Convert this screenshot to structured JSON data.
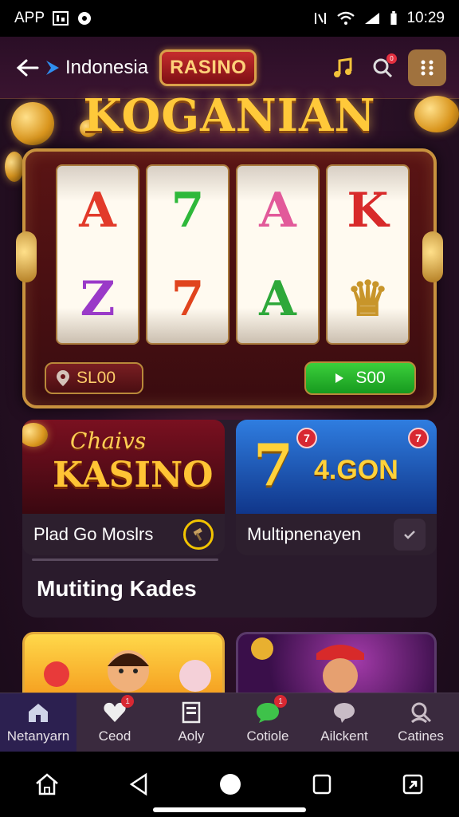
{
  "status_bar": {
    "app_label": "APP",
    "time": "10:29"
  },
  "header": {
    "region": "Indonesia",
    "brand": "RASINO",
    "notif_count": "0"
  },
  "hero": {
    "title": "KOGANIAN"
  },
  "slot": {
    "reels": [
      {
        "symbols": [
          "A",
          "Z"
        ]
      },
      {
        "symbols": [
          "7",
          "7"
        ]
      },
      {
        "symbols": [
          "A",
          "A"
        ]
      },
      {
        "symbols": [
          "K",
          "♛"
        ]
      }
    ],
    "bet_left": "SL00",
    "bet_right": "S00"
  },
  "cards": [
    {
      "art_line1": "Chaivs",
      "art_line2": "KASINO",
      "label": "Plad Go Moslrs"
    },
    {
      "art_seven": "7",
      "art_value": "4.GON",
      "label": "Multipnenayen",
      "badge_left": "7",
      "badge_right": "7"
    }
  ],
  "section": {
    "title": "Mutiting Kades"
  },
  "tabs": [
    {
      "label": "Netanyarn",
      "icon": "home-icon"
    },
    {
      "label": "Ceod",
      "icon": "heart-icon",
      "badge": "1"
    },
    {
      "label": "Aoly",
      "icon": "document-icon"
    },
    {
      "label": "Cotiole",
      "icon": "chat-icon",
      "badge": "1"
    },
    {
      "label": "Ailckent",
      "icon": "bubble-icon"
    },
    {
      "label": "Catines",
      "icon": "search-user-icon"
    }
  ],
  "colors": {
    "accent_gold": "#ffc93a",
    "active_tab": "#2c2050",
    "badge_red": "#d82832",
    "bet_green": "#3bcf3b"
  }
}
